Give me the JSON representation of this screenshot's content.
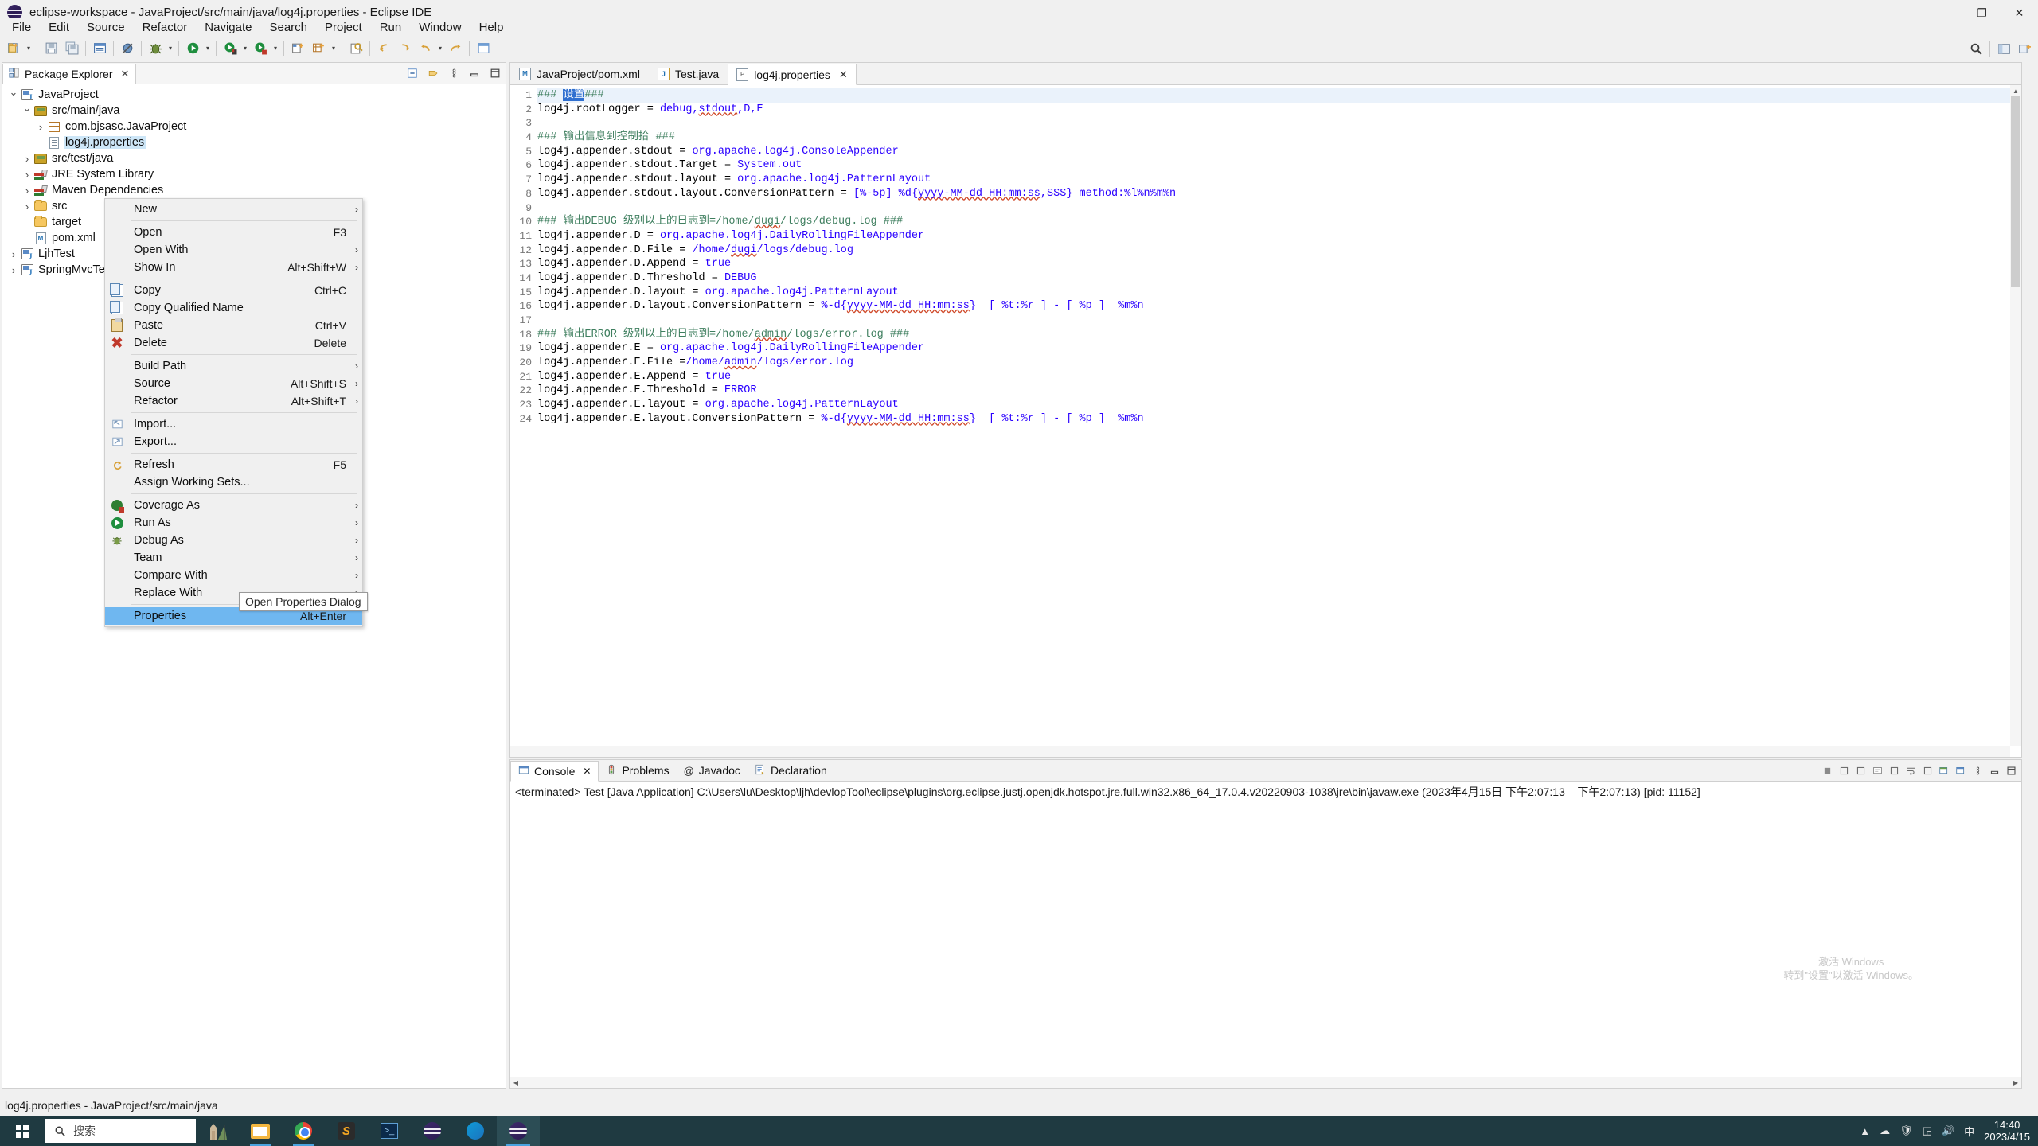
{
  "titlebar": {
    "title": "eclipse-workspace - JavaProject/src/main/java/log4j.properties - Eclipse IDE",
    "icon": "eclipse-icon",
    "minimize": "—",
    "maximize": "❐",
    "close": "✕"
  },
  "menubar": {
    "items": [
      "File",
      "Edit",
      "Source",
      "Refactor",
      "Navigate",
      "Search",
      "Project",
      "Run",
      "Window",
      "Help"
    ]
  },
  "toolbar": {
    "right_icons": [
      "search-icon",
      "perspective-java-icon",
      "perspective-add-icon"
    ]
  },
  "package_explorer": {
    "tab_label": "Package Explorer",
    "tab_close": "✕",
    "tools": [
      "collapse-all-icon",
      "link-with-editor-icon",
      "view-menu-icon",
      "minimize-icon",
      "maximize-icon"
    ],
    "tree": [
      {
        "label": "JavaProject",
        "indent": 0,
        "arrow": "open",
        "icon": "java-project-icon",
        "selected": false
      },
      {
        "label": "src/main/java",
        "indent": 1,
        "arrow": "open",
        "icon": "source-folder-icon",
        "selected": false
      },
      {
        "label": "com.bjsasc.JavaProject",
        "indent": 2,
        "arrow": "closed",
        "icon": "package-icon",
        "selected": false
      },
      {
        "label": "log4j.properties",
        "indent": 2,
        "arrow": "none",
        "icon": "file-icon",
        "selected": true
      },
      {
        "label": "src/test/java",
        "indent": 1,
        "arrow": "closed",
        "icon": "source-folder-icon",
        "selected": false
      },
      {
        "label": "JRE System Library",
        "indent": 1,
        "arrow": "closed",
        "icon": "library-icon",
        "selected": false
      },
      {
        "label": "Maven Dependencies",
        "indent": 1,
        "arrow": "closed",
        "icon": "library-icon",
        "selected": false
      },
      {
        "label": "src",
        "indent": 1,
        "arrow": "closed",
        "icon": "folder-icon",
        "selected": false
      },
      {
        "label": "target",
        "indent": 1,
        "arrow": "none",
        "icon": "folder-icon",
        "selected": false
      },
      {
        "label": "pom.xml",
        "indent": 1,
        "arrow": "none",
        "icon": "maven-file-icon",
        "selected": false
      },
      {
        "label": "LjhTest",
        "indent": 0,
        "arrow": "closed",
        "icon": "java-project-icon",
        "selected": false
      },
      {
        "label": "SpringMvcTest",
        "indent": 0,
        "arrow": "closed",
        "icon": "java-project-icon",
        "selected": false
      }
    ]
  },
  "context_menu": {
    "items": [
      {
        "label": "New",
        "icon": "",
        "accel": "",
        "submenu": true,
        "sep_after": true,
        "selected": false
      },
      {
        "label": "Open",
        "icon": "",
        "accel": "F3",
        "submenu": false,
        "sep_after": false,
        "selected": false
      },
      {
        "label": "Open With",
        "icon": "",
        "accel": "",
        "submenu": true,
        "sep_after": false,
        "selected": false
      },
      {
        "label": "Show In",
        "icon": "",
        "accel": "Alt+Shift+W",
        "submenu": true,
        "sep_after": true,
        "selected": false
      },
      {
        "label": "Copy",
        "icon": "copy-icon",
        "accel": "Ctrl+C",
        "submenu": false,
        "sep_after": false,
        "selected": false
      },
      {
        "label": "Copy Qualified Name",
        "icon": "copy-qname-icon",
        "accel": "",
        "submenu": false,
        "sep_after": false,
        "selected": false
      },
      {
        "label": "Paste",
        "icon": "paste-icon",
        "accel": "Ctrl+V",
        "submenu": false,
        "sep_after": false,
        "selected": false
      },
      {
        "label": "Delete",
        "icon": "delete-icon",
        "accel": "Delete",
        "submenu": false,
        "sep_after": true,
        "selected": false
      },
      {
        "label": "Build Path",
        "icon": "",
        "accel": "",
        "submenu": true,
        "sep_after": false,
        "selected": false
      },
      {
        "label": "Source",
        "icon": "",
        "accel": "Alt+Shift+S",
        "submenu": true,
        "sep_after": false,
        "selected": false
      },
      {
        "label": "Refactor",
        "icon": "",
        "accel": "Alt+Shift+T",
        "submenu": true,
        "sep_after": true,
        "selected": false
      },
      {
        "label": "Import...",
        "icon": "import-icon",
        "accel": "",
        "submenu": false,
        "sep_after": false,
        "selected": false
      },
      {
        "label": "Export...",
        "icon": "export-icon",
        "accel": "",
        "submenu": false,
        "sep_after": true,
        "selected": false
      },
      {
        "label": "Refresh",
        "icon": "refresh-icon",
        "accel": "F5",
        "submenu": false,
        "sep_after": false,
        "selected": false
      },
      {
        "label": "Assign Working Sets...",
        "icon": "",
        "accel": "",
        "submenu": false,
        "sep_after": true,
        "selected": false
      },
      {
        "label": "Coverage As",
        "icon": "coverage-icon",
        "accel": "",
        "submenu": true,
        "sep_after": false,
        "selected": false
      },
      {
        "label": "Run As",
        "icon": "run-icon",
        "accel": "",
        "submenu": true,
        "sep_after": false,
        "selected": false
      },
      {
        "label": "Debug As",
        "icon": "debug-icon",
        "accel": "",
        "submenu": true,
        "sep_after": false,
        "selected": false
      },
      {
        "label": "Team",
        "icon": "",
        "accel": "",
        "submenu": true,
        "sep_after": false,
        "selected": false
      },
      {
        "label": "Compare With",
        "icon": "",
        "accel": "",
        "submenu": true,
        "sep_after": false,
        "selected": false
      },
      {
        "label": "Replace With",
        "icon": "",
        "accel": "",
        "submenu": true,
        "sep_after": true,
        "selected": false
      },
      {
        "label": "Properties",
        "icon": "",
        "accel": "Alt+Enter",
        "submenu": false,
        "sep_after": false,
        "selected": true
      }
    ]
  },
  "tooltip": {
    "text": "Open Properties Dialog"
  },
  "editor": {
    "tabs": [
      {
        "label": "JavaProject/pom.xml",
        "icon": "maven-file-icon",
        "active": false,
        "closable": false
      },
      {
        "label": "Test.java",
        "icon": "java-file-icon",
        "active": false,
        "closable": false
      },
      {
        "label": "log4j.properties",
        "icon": "properties-file-icon",
        "active": true,
        "closable": true,
        "close": "✕"
      }
    ],
    "lines": [
      {
        "n": 1,
        "highlight": true,
        "parts": [
          {
            "t": "### ",
            "c": "comment"
          },
          {
            "t": "设置",
            "c": "selection"
          },
          {
            "t": "###",
            "c": "comment"
          }
        ]
      },
      {
        "n": 2,
        "highlight": false,
        "parts": [
          {
            "t": "log4j.rootLogger = ",
            "c": "plain"
          },
          {
            "t": "debug,",
            "c": "value"
          },
          {
            "t": "stdout",
            "c": "value-sq"
          },
          {
            "t": ",D,E",
            "c": "value"
          }
        ]
      },
      {
        "n": 3,
        "highlight": false,
        "parts": []
      },
      {
        "n": 4,
        "highlight": false,
        "parts": [
          {
            "t": "### 输出信息到控制拾 ###",
            "c": "comment"
          }
        ]
      },
      {
        "n": 5,
        "highlight": false,
        "parts": [
          {
            "t": "log4j.appender.stdout = ",
            "c": "plain"
          },
          {
            "t": "org.apache.log4j.ConsoleAppender",
            "c": "value"
          }
        ]
      },
      {
        "n": 6,
        "highlight": false,
        "parts": [
          {
            "t": "log4j.appender.stdout.Target = ",
            "c": "plain"
          },
          {
            "t": "System.out",
            "c": "value"
          }
        ]
      },
      {
        "n": 7,
        "highlight": false,
        "parts": [
          {
            "t": "log4j.appender.stdout.layout = ",
            "c": "plain"
          },
          {
            "t": "org.apache.log4j.PatternLayout",
            "c": "value"
          }
        ]
      },
      {
        "n": 8,
        "highlight": false,
        "parts": [
          {
            "t": "log4j.appender.stdout.layout.ConversionPattern = ",
            "c": "plain"
          },
          {
            "t": "[%-5p] %d{",
            "c": "value"
          },
          {
            "t": "yyyy-MM-dd HH:mm:ss",
            "c": "value-sq"
          },
          {
            "t": ",SSS} method:%l%n%m%n",
            "c": "value"
          }
        ]
      },
      {
        "n": 9,
        "highlight": false,
        "parts": []
      },
      {
        "n": 10,
        "highlight": false,
        "parts": [
          {
            "t": "### 输出DEBUG 级别以上的日志到",
            "c": "comment"
          },
          {
            "t": "=/home/",
            "c": "comment"
          },
          {
            "t": "dugi",
            "c": "comment-sq"
          },
          {
            "t": "/logs/debug.log ###",
            "c": "comment"
          }
        ]
      },
      {
        "n": 11,
        "highlight": false,
        "parts": [
          {
            "t": "log4j.appender.D = ",
            "c": "plain"
          },
          {
            "t": "org.apache.log4j.DailyRollingFileAppender",
            "c": "value"
          }
        ]
      },
      {
        "n": 12,
        "highlight": false,
        "parts": [
          {
            "t": "log4j.appender.D.File = ",
            "c": "plain"
          },
          {
            "t": "/home/",
            "c": "value"
          },
          {
            "t": "dugi",
            "c": "value-sq"
          },
          {
            "t": "/logs/debug.log",
            "c": "value"
          }
        ]
      },
      {
        "n": 13,
        "highlight": false,
        "parts": [
          {
            "t": "log4j.appender.D.Append = ",
            "c": "plain"
          },
          {
            "t": "true",
            "c": "value"
          }
        ]
      },
      {
        "n": 14,
        "highlight": false,
        "parts": [
          {
            "t": "log4j.appender.D.Threshold = ",
            "c": "plain"
          },
          {
            "t": "DEBUG",
            "c": "value"
          }
        ]
      },
      {
        "n": 15,
        "highlight": false,
        "parts": [
          {
            "t": "log4j.appender.D.layout = ",
            "c": "plain"
          },
          {
            "t": "org.apache.log4j.PatternLayout",
            "c": "value"
          }
        ]
      },
      {
        "n": 16,
        "highlight": false,
        "parts": [
          {
            "t": "log4j.appender.D.layout.ConversionPattern = ",
            "c": "plain"
          },
          {
            "t": "%-d{",
            "c": "value"
          },
          {
            "t": "yyyy-MM-dd HH:mm:ss",
            "c": "value-sq"
          },
          {
            "t": "}  [ %t:%r ] - [ %p ]  %m%n",
            "c": "value"
          }
        ]
      },
      {
        "n": 17,
        "highlight": false,
        "parts": []
      },
      {
        "n": 18,
        "highlight": false,
        "parts": [
          {
            "t": "### 输出ERROR 级别以上的日志到",
            "c": "comment"
          },
          {
            "t": "=/home/",
            "c": "comment"
          },
          {
            "t": "admin",
            "c": "comment-sq"
          },
          {
            "t": "/logs/error.log ###",
            "c": "comment"
          }
        ]
      },
      {
        "n": 19,
        "highlight": false,
        "parts": [
          {
            "t": "log4j.appender.E = ",
            "c": "plain"
          },
          {
            "t": "org.apache.log4j.DailyRollingFileAppender",
            "c": "value"
          }
        ]
      },
      {
        "n": 20,
        "highlight": false,
        "parts": [
          {
            "t": "log4j.appender.E.File =",
            "c": "plain"
          },
          {
            "t": "/home/",
            "c": "value"
          },
          {
            "t": "admin",
            "c": "value-sq"
          },
          {
            "t": "/logs/error.log",
            "c": "value"
          }
        ]
      },
      {
        "n": 21,
        "highlight": false,
        "parts": [
          {
            "t": "log4j.appender.E.Append = ",
            "c": "plain"
          },
          {
            "t": "true",
            "c": "value"
          }
        ]
      },
      {
        "n": 22,
        "highlight": false,
        "parts": [
          {
            "t": "log4j.appender.E.Threshold = ",
            "c": "plain"
          },
          {
            "t": "ERROR",
            "c": "value"
          }
        ]
      },
      {
        "n": 23,
        "highlight": false,
        "parts": [
          {
            "t": "log4j.appender.E.layout = ",
            "c": "plain"
          },
          {
            "t": "org.apache.log4j.PatternLayout",
            "c": "value"
          }
        ]
      },
      {
        "n": 24,
        "highlight": false,
        "parts": [
          {
            "t": "log4j.appender.E.layout.ConversionPattern = ",
            "c": "plain"
          },
          {
            "t": "%-d{",
            "c": "value"
          },
          {
            "t": "yyyy-MM-dd HH:mm:ss",
            "c": "value-sq"
          },
          {
            "t": "}  [ %t:%r ] - [ %p ]  %m%n",
            "c": "value"
          }
        ]
      }
    ]
  },
  "console": {
    "tabs": [
      {
        "label": "Console",
        "icon": "console-icon",
        "active": true,
        "closable": true,
        "close": "✕"
      },
      {
        "label": "Problems",
        "icon": "problems-icon",
        "active": false,
        "closable": false
      },
      {
        "label": "Javadoc",
        "icon": "javadoc-icon",
        "active": false,
        "closable": false
      },
      {
        "label": "Declaration",
        "icon": "declaration-icon",
        "active": false,
        "closable": false
      }
    ],
    "output": "<terminated> Test [Java Application] C:\\Users\\lu\\Desktop\\ljh\\devlopTool\\eclipse\\plugins\\org.eclipse.justj.openjdk.hotspot.jre.full.win32.x86_64_17.0.4.v20220903-1038\\jre\\bin\\javaw.exe  (2023年4月15日 下午2:07:13 – 下午2:07:13) [pid: 11152]",
    "tools": [
      "terminate-icon",
      "remove-launch-icon",
      "remove-all-icon",
      "clear-console-icon",
      "scroll-lock-icon",
      "word-wrap-icon",
      "pin-console-icon",
      "display-selected-icon",
      "open-console-icon",
      "view-menu-icon",
      "minimize-icon",
      "maximize-icon"
    ]
  },
  "statusbar": {
    "text": "log4j.properties - JavaProject/src/main/java"
  },
  "taskbar": {
    "start_label": "start-icon",
    "search_placeholder": "搜索",
    "apps": [
      {
        "name": "file-explorer-icon",
        "state": "open"
      },
      {
        "name": "chrome-icon",
        "state": "open"
      },
      {
        "name": "sublime-icon",
        "state": "idle"
      },
      {
        "name": "powershell-icon",
        "state": "idle"
      },
      {
        "name": "eclipse-icon",
        "state": "idle"
      },
      {
        "name": "edge-icon",
        "state": "idle"
      },
      {
        "name": "eclipse-icon-2",
        "state": "active"
      }
    ],
    "clock_time": "14:40",
    "clock_date": "2023/4/15",
    "tray_icons": [
      "chevron-up-icon",
      "cloud-icon",
      "shield-icon",
      "network-icon",
      "volume-icon",
      "ime-icon"
    ]
  },
  "watermark": {
    "line1": "激活 Windows",
    "line2": "转到\"设置\"以激活 Windows。"
  },
  "colors": {
    "selection_blue": "#6fb7f0",
    "tree_select": "#cde6f7",
    "comment_green": "#3f7f5f",
    "value_blue": "#2a00ff",
    "taskbar_bg": "#1f3a41"
  }
}
